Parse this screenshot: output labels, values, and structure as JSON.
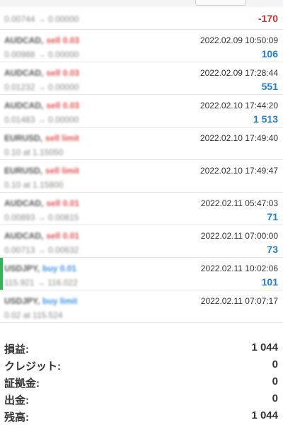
{
  "orders": [
    {
      "symbol": "",
      "type": "",
      "type_class": "",
      "detail": "0.00744 → 0.00000",
      "date": "",
      "profit": "-170",
      "profit_class": "neg"
    },
    {
      "symbol": "AUDCAD,",
      "type": "sell 0.03",
      "type_class": "sell",
      "detail": "0.00988 → 0.00000",
      "date": "2022.02.09 10:50:09",
      "profit": "106",
      "profit_class": "pos"
    },
    {
      "symbol": "AUDCAD,",
      "type": "sell 0.03",
      "type_class": "sell",
      "detail": "0.01232 → 0.00000",
      "date": "2022.02.09 17:28:44",
      "profit": "551",
      "profit_class": "pos"
    },
    {
      "symbol": "AUDCAD,",
      "type": "sell 0.03",
      "type_class": "sell",
      "detail": "0.01483 → 0.00000",
      "date": "2022.02.10 17:44:20",
      "profit": "1 513",
      "profit_class": "pos"
    },
    {
      "symbol": "EURUSD,",
      "type": "sell limit",
      "type_class": "sell",
      "detail": "0.10 at 1.15050",
      "date": "2022.02.10 17:49:40",
      "profit": "",
      "profit_class": "pos"
    },
    {
      "symbol": "EURUSD,",
      "type": "sell limit",
      "type_class": "sell",
      "detail": "0.10 at 1.15800",
      "date": "2022.02.10 17:49:47",
      "profit": "",
      "profit_class": "pos"
    },
    {
      "symbol": "AUDCAD,",
      "type": "sell 0.01",
      "type_class": "sell",
      "detail": "0.00893 → 0.00815",
      "date": "2022.02.11 05:47:03",
      "profit": "71",
      "profit_class": "pos"
    },
    {
      "symbol": "AUDCAD,",
      "type": "sell 0.01",
      "type_class": "sell",
      "detail": "0.00713 → 0.00632",
      "date": "2022.02.11 07:00:00",
      "profit": "73",
      "profit_class": "pos"
    },
    {
      "symbol": "USDJPY,",
      "type": "buy 0.01",
      "type_class": "buy",
      "detail": "115.921 → 116.022",
      "date": "2022.02.11 10:02:06",
      "profit": "101",
      "profit_class": "pos",
      "highlight": true
    },
    {
      "symbol": "USDJPY,",
      "type": "buy limit",
      "type_class": "buy",
      "detail": "0.02 at 115.524",
      "date": "2022.02.11 07:07:17",
      "profit": "",
      "profit_class": "pos"
    }
  ],
  "summary": {
    "profit_label": "損益:",
    "profit_value": "1 044",
    "credit_label": "クレジット:",
    "credit_value": "0",
    "deposit_label": "証拠金:",
    "deposit_value": "0",
    "withdrawal_label": "出金:",
    "withdrawal_value": "0",
    "balance_label": "残高:",
    "balance_value": "1 044"
  },
  "colors": {
    "profit_positive": "#1f7fd0",
    "profit_negative": "#d0302a",
    "sell": "#e05050",
    "buy": "#3b8fe0",
    "highlight_bar": "#33b35a"
  }
}
